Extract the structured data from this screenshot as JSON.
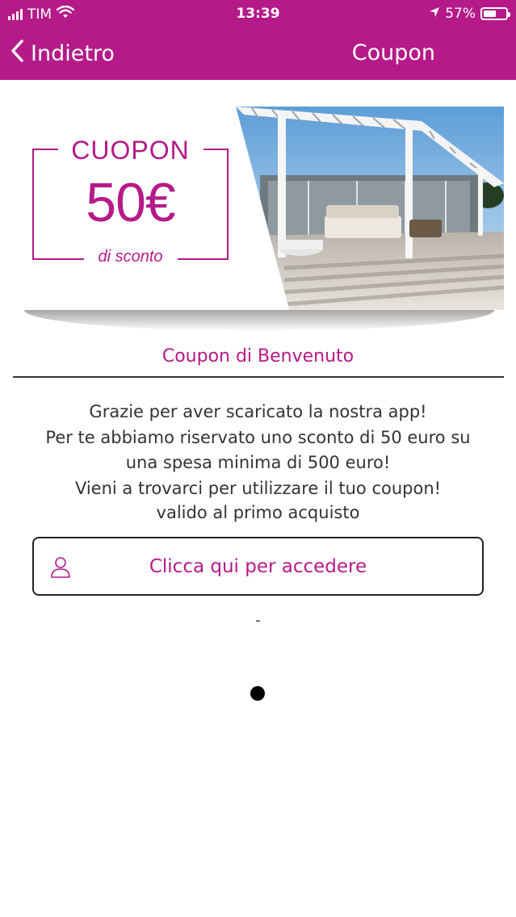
{
  "status_bar": {
    "carrier": "TIM",
    "time": "13:39",
    "battery": "57%",
    "battery_level": 0.57,
    "icons": [
      "signal-bars-icon",
      "wifi-icon",
      "location-arrow-icon",
      "battery-icon"
    ]
  },
  "nav": {
    "back_label": "Indietro",
    "title": "Coupon",
    "icons": [
      "chevron-left-icon"
    ]
  },
  "banner": {
    "heading": "CUOPON",
    "amount": "50€",
    "subtitle": "di sconto",
    "brand_color": "#b51a88"
  },
  "content": {
    "section_title": "Coupon di Benvenuto",
    "body_lines": [
      "Grazie per aver scaricato la nostra app!",
      "Per te abbiamo riservato uno sconto di 50 euro su",
      "una spesa minima di 500 euro!",
      "Vieni a trovarci per utilizzare il tuo coupon!"
    ],
    "validity": "valido al primo acquisto",
    "login_button": "Clicca qui per accedere",
    "login_icon": "user-icon",
    "separator": "-"
  },
  "colors": {
    "header_bg": "#b51a88",
    "accent": "#b51a88",
    "text": "#333333"
  }
}
